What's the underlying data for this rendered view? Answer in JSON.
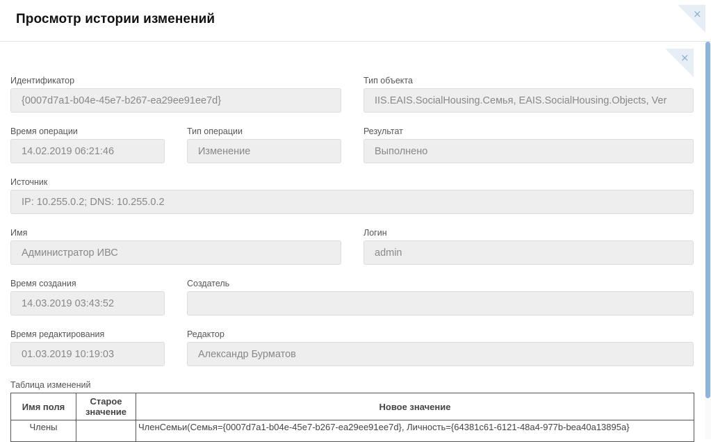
{
  "dialog": {
    "title": "Просмотр истории изменений",
    "close_symbol": "×"
  },
  "panel": {
    "close_symbol": "×"
  },
  "fields": {
    "identifier": {
      "label": "Идентификатор",
      "value": "{0007d7a1-b04e-45e7-b267-ea29ee91ee7d}"
    },
    "object_type": {
      "label": "Тип объекта",
      "value": "IIS.EAIS.SocialHousing.Семья, EAIS.SocialHousing.Objects, Ver"
    },
    "operation_time": {
      "label": "Время операции",
      "value": "14.02.2019 06:21:46"
    },
    "operation_type": {
      "label": "Тип операции",
      "value": "Изменение"
    },
    "result": {
      "label": "Результат",
      "value": "Выполнено"
    },
    "source": {
      "label": "Источник",
      "value": "IP: 10.255.0.2; DNS: 10.255.0.2"
    },
    "name": {
      "label": "Имя",
      "value": "Администратор ИВС"
    },
    "login": {
      "label": "Логин",
      "value": "admin"
    },
    "created_time": {
      "label": "Время создания",
      "value": "14.03.2019 03:43:52"
    },
    "creator": {
      "label": "Создатель",
      "value": ""
    },
    "edited_time": {
      "label": "Время редактирования",
      "value": "01.03.2019 10:19:03"
    },
    "editor": {
      "label": "Редактор",
      "value": "Александр Бурматов"
    }
  },
  "changes_table": {
    "label": "Таблица изменений",
    "columns": [
      "Имя поля",
      "Старое значение",
      "Новое значение"
    ],
    "rows": [
      {
        "field": "Члены",
        "old": "",
        "new": "ЧленСемьи(Семья={0007d7a1-b04e-45e7-b267-ea29ee91ee7d}, Личность={64381c61-6121-48a4-977b-bea40a13895a}"
      }
    ]
  },
  "colors": {
    "accent": "#8fb4dc",
    "field_bg": "#eeeeee"
  }
}
